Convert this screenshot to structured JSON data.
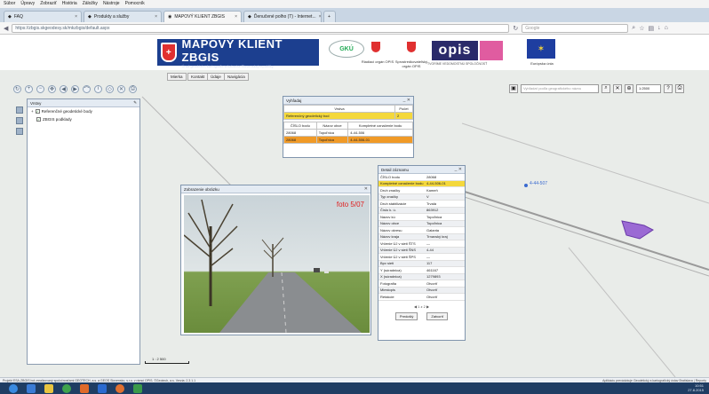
{
  "browser": {
    "menu": [
      "Súbor",
      "Úpravy",
      "Zobraziť",
      "História",
      "Záložky",
      "Nástroje",
      "Pomocník"
    ],
    "tabs": [
      {
        "label": "FAQ"
      },
      {
        "label": "Produkty a služby"
      },
      {
        "label": "MAPOVÝ KLIENT ZBGIS"
      },
      {
        "label": "Ďenučené polho (T) - Internet..."
      }
    ],
    "url": "https://zbgis.skgeodesy.sk/mkzbgis/default.aspx",
    "search_placeholder": "Google"
  },
  "header": {
    "logo_title": "MAPOVÝ KLIENT ZBGIS",
    "logo_sub": "Úrad geodézie, kartografie a katastra Slovenskej republiky",
    "partner1": "Riadiaci orgán OPIS",
    "partner2": "Sprostredkovateľský orgán OPIS",
    "opis": "opis",
    "opis_sub": "TVORÍME VEDOMOSTNÚ SPOLOČNOSŤ",
    "eu_label": "Európska únia"
  },
  "map_tabs": [
    "Mierka",
    "Kontakt",
    "Údaje",
    "Navigácia"
  ],
  "map_search": {
    "placeholder": "Vyhľadať podľa geografického názvu",
    "scale": "1:2500"
  },
  "layers_panel": {
    "title": "Vrstvy",
    "items": [
      {
        "label": "Referenčné geodetické body"
      },
      {
        "label": "ZBGIS podklady"
      }
    ]
  },
  "legenda": {
    "title": "Vyhľadaj",
    "col1": "Vrstva",
    "col2": "Počet",
    "row_label": "Referenčný geodetický bod",
    "row_count": "2",
    "sub_headers": [
      "ČÍSLO bodu",
      "Názov obce",
      "Kompletné označenie bodu"
    ],
    "rows": [
      {
        "cislo": "28068",
        "obec": "Topoľnica",
        "oznacenie": "4-44-506"
      },
      {
        "cislo": "28068",
        "obec": "Topoľnica",
        "oznacenie": "4-44-506-01"
      }
    ]
  },
  "photo_window": {
    "title": "Zobrazenie obrázku",
    "label": "foto 5/07"
  },
  "detail": {
    "title": "Detail záznamu",
    "rows": [
      {
        "k": "ČÍSLO bodu",
        "v": "28068"
      },
      {
        "k": "Kompletné označenie bodu",
        "v": "4-44-506-01"
      },
      {
        "k": "Druh značky",
        "v": "Kameň"
      },
      {
        "k": "Typ značky",
        "v": "V"
      },
      {
        "k": "Druh stabilizácie",
        "v": "Trvalá"
      },
      {
        "k": "Číslo k. ú.",
        "v": "863912"
      },
      {
        "k": "Názov kú",
        "v": "Topoľnica"
      },
      {
        "k": "Názov obce",
        "v": "Topoľnica"
      },
      {
        "k": "Názov okresu",
        "v": "Galanta"
      },
      {
        "k": "Názov kraja",
        "v": "Trnavský kraj"
      },
      {
        "k": "Vrčenie ÚJ v sieti ŠTS",
        "v": "—"
      },
      {
        "k": "Vrčenie ÚJ v sieti ŠNS",
        "v": "4-44"
      },
      {
        "k": "Vrčenie ÚJ v sieti ŠPS",
        "v": "—"
      },
      {
        "k": "Bpv sieti",
        "v": "117"
      },
      {
        "k": "Y (súradnica)",
        "v": "461167"
      },
      {
        "k": "X (súradnica)",
        "v": "1279893"
      },
      {
        "k": "Fotografia",
        "v": "Otvoriť"
      },
      {
        "k": "Miestopis",
        "v": "Otvoriť"
      },
      {
        "k": "Retakcie",
        "v": "Otvoriť"
      }
    ],
    "pager": "1 z 2",
    "btn_prev": "Predošlý",
    "btn_next": "Zatvoriť"
  },
  "map_labels": {
    "point": "4-44-507",
    "scale_bar": "1 : 2 500"
  },
  "status": {
    "left": "Projekt ESA-ZBGIS bol zrealizovaný spoločnosťami GEOTECH, a.s. a GEOS Slovensko, s.r.o. v rámci OPIS. ©Geotech, a.s. Verzia: 2.3.1.1",
    "right": "Aplikáciu prevádzkuje Geodetický a kartografický ústav Bratislava | Reporty"
  },
  "tray": {
    "time": "10:51",
    "date": "27.8.2015"
  }
}
